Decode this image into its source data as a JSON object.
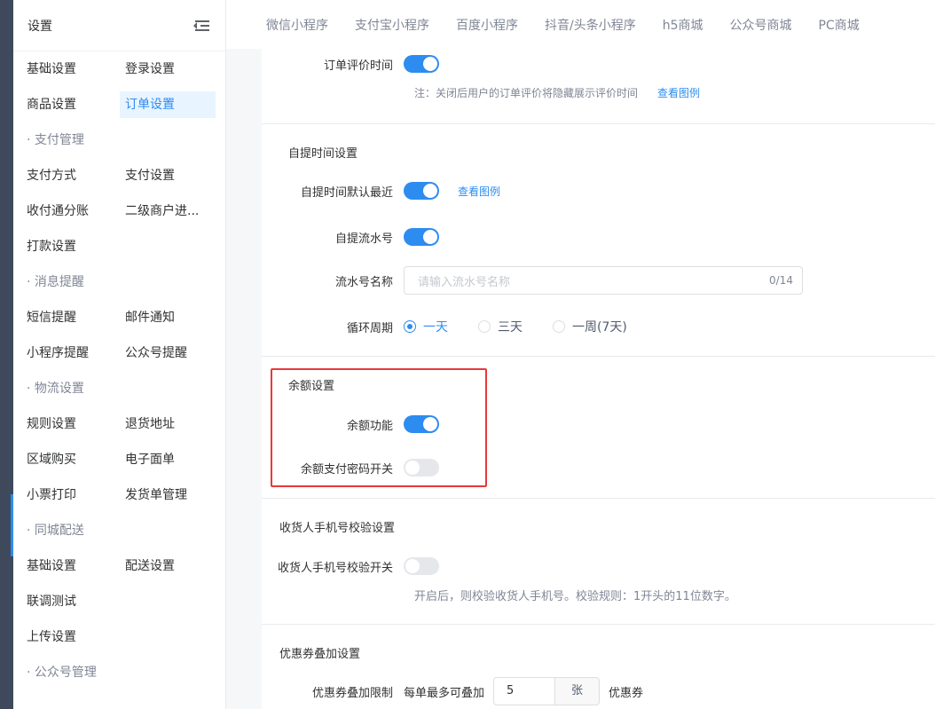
{
  "sidebar": {
    "title": "设置",
    "rows": [
      {
        "type": "pair",
        "items": [
          "基础设置",
          "登录设置"
        ]
      },
      {
        "type": "pair",
        "items": [
          "商品设置",
          "订单设置"
        ],
        "active": 1
      },
      {
        "type": "section",
        "label": "· 支付管理"
      },
      {
        "type": "pair",
        "items": [
          "支付方式",
          "支付设置"
        ]
      },
      {
        "type": "pair",
        "items": [
          "收付通分账",
          "二级商户进..."
        ]
      },
      {
        "type": "pair",
        "items": [
          "打款设置",
          ""
        ]
      },
      {
        "type": "section",
        "label": "· 消息提醒"
      },
      {
        "type": "pair",
        "items": [
          "短信提醒",
          "邮件通知"
        ]
      },
      {
        "type": "pair",
        "items": [
          "小程序提醒",
          "公众号提醒"
        ]
      },
      {
        "type": "section",
        "label": "· 物流设置"
      },
      {
        "type": "pair",
        "items": [
          "规则设置",
          "退货地址"
        ]
      },
      {
        "type": "pair",
        "items": [
          "区域购买",
          "电子面单"
        ]
      },
      {
        "type": "pair",
        "items": [
          "小票打印",
          "发货单管理"
        ]
      },
      {
        "type": "section",
        "label": "· 同城配送"
      },
      {
        "type": "pair",
        "items": [
          "基础设置",
          "配送设置"
        ]
      },
      {
        "type": "pair",
        "items": [
          "联调测试",
          ""
        ]
      },
      {
        "type": "pair",
        "items": [
          "上传设置",
          ""
        ]
      },
      {
        "type": "section",
        "label": "· 公众号管理"
      }
    ]
  },
  "tabs": [
    "微信小程序",
    "支付宝小程序",
    "百度小程序",
    "抖音/头条小程序",
    "h5商城",
    "公众号商城",
    "PC商城"
  ],
  "order_review": {
    "label": "订单评价时间",
    "enabled": true,
    "note": "注：关闭后用户的订单评价将隐藏展示评价时间",
    "link": "查看图例"
  },
  "pickup": {
    "title": "自提时间设置",
    "default_recent_label": "自提时间默认最近",
    "default_recent_link": "查看图例",
    "serial_label": "自提流水号",
    "serial_name_label": "流水号名称",
    "serial_name_placeholder": "请输入流水号名称",
    "serial_name_count": "0/14",
    "cycle_label": "循环周期",
    "cycle_options": [
      "一天",
      "三天",
      "一周(7天)"
    ],
    "cycle_selected": 0
  },
  "balance": {
    "title": "余额设置",
    "feature_label": "余额功能",
    "feature_enabled": true,
    "password_label": "余额支付密码开关",
    "password_enabled": false
  },
  "phone_check": {
    "title": "收货人手机号校验设置",
    "switch_label": "收货人手机号校验开关",
    "enabled": false,
    "note": "开启后，则校验收货人手机号。校验规则：1开头的11位数字。"
  },
  "coupon": {
    "title": "优惠券叠加设置",
    "limit_label": "优惠券叠加限制",
    "prefix": "每单最多可叠加",
    "value": "5",
    "unit": "张",
    "suffix": "优惠券"
  },
  "colors": {
    "accent": "#2d8cf0",
    "highlight_border": "#e8393a",
    "sidebar_dark": "#3e4a5b"
  }
}
